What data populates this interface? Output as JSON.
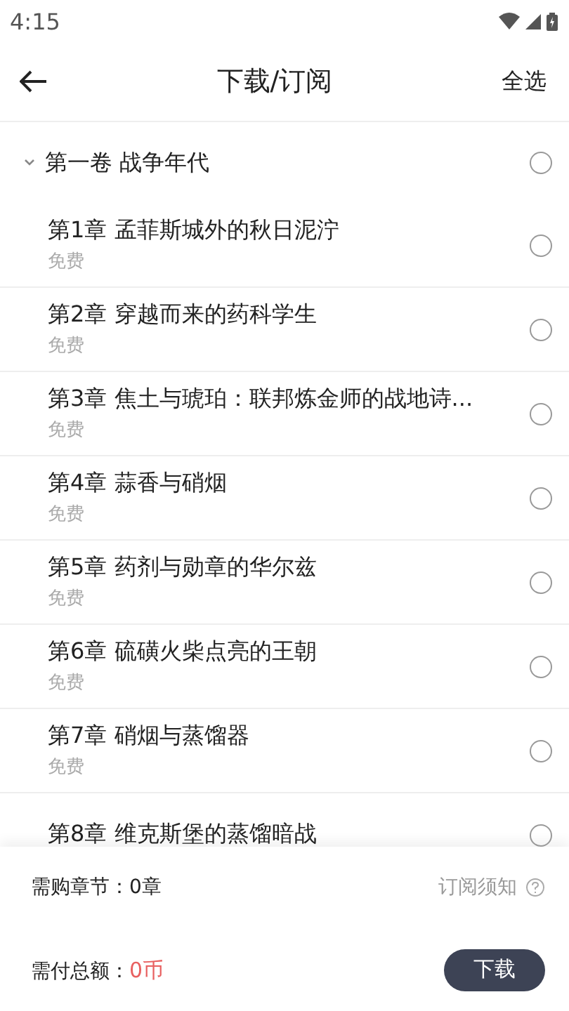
{
  "status_bar": {
    "time": "4:15"
  },
  "header": {
    "title": "下载/订阅",
    "action": "全选"
  },
  "volumes": [
    {
      "title": "第一卷 战争年代",
      "expanded": true,
      "selected": false,
      "children": [
        {
          "title": "第1章 孟菲斯城外的秋日泥泞",
          "price": "免费",
          "selected": false
        },
        {
          "title": "第2章 穿越而来的药科学生",
          "price": "免费",
          "selected": false
        },
        {
          "title": "第3章 焦土与琥珀：联邦炼金师的战地诗...",
          "price": "免费",
          "selected": false
        },
        {
          "title": "第4章 蒜香与硝烟",
          "price": "免费",
          "selected": false
        },
        {
          "title": "第5章 药剂与勋章的华尔兹",
          "price": "免费",
          "selected": false
        },
        {
          "title": "第6章 硫磺火柴点亮的王朝",
          "price": "免费",
          "selected": false
        },
        {
          "title": "第7章 硝烟与蒸馏器",
          "price": "免费",
          "selected": false
        },
        {
          "title": "第8章 维克斯堡的蒸馏暗战",
          "selected": false
        }
      ]
    }
  ],
  "footer": {
    "chapters_label": "需购章节：",
    "chapters_value": "0章",
    "notice": "订阅须知",
    "total_label": "需付总额：",
    "total_value": "0币",
    "download_button": "下载"
  }
}
